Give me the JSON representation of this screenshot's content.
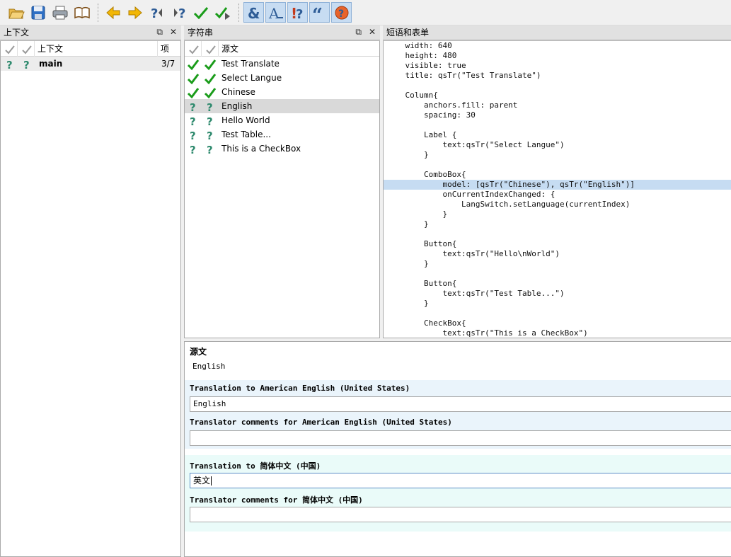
{
  "toolbar": {
    "icons": [
      "open-folder-icon",
      "save-icon",
      "print-icon",
      "phrasebook-icon",
      "arrow-left-icon",
      "arrow-right-icon",
      "prev-unfinished-icon",
      "next-unfinished-icon",
      "done-icon",
      "done-and-next-icon",
      "accelerator-validation-icon",
      "punctuation-validation-icon",
      "phrase-validation-icon",
      "quote-validation-icon",
      "placeholder-validation-icon"
    ]
  },
  "context_panel": {
    "title": "上下文",
    "col_name": "上下文",
    "col_items": "项",
    "rows": [
      {
        "name": "main",
        "items": "3/7"
      }
    ]
  },
  "strings_panel": {
    "title": "字符串",
    "col_source": "源文",
    "rows": [
      {
        "text": "Test Translate",
        "status": "done"
      },
      {
        "text": "Select Langue",
        "status": "done"
      },
      {
        "text": "Chinese",
        "status": "done"
      },
      {
        "text": "English",
        "status": "unfinished",
        "selected": true
      },
      {
        "text": "Hello World",
        "status": "unfinished"
      },
      {
        "text": "Test Table...",
        "status": "unfinished"
      },
      {
        "text": "This is a CheckBox",
        "status": "unfinished"
      }
    ]
  },
  "phrases_panel": {
    "title": "短语和表单",
    "code_lines": [
      "    width: 640",
      "    height: 480",
      "    visible: true",
      "    title: qsTr(\"Test Translate\")",
      "",
      "    Column{",
      "        anchors.fill: parent",
      "        spacing: 30",
      "",
      "        Label {",
      "            text:qsTr(\"Select Langue\")",
      "        }",
      "",
      "        ComboBox{",
      "            model: [qsTr(\"Chinese\"), qsTr(\"English\")]",
      "            onCurrentIndexChanged: {",
      "                LangSwitch.setLanguage(currentIndex)",
      "            }",
      "        }",
      "",
      "        Button{",
      "            text:qsTr(\"Hello\\nWorld\")",
      "        }",
      "",
      "        Button{",
      "            text:qsTr(\"Test Table...\")",
      "        }",
      "",
      "        CheckBox{",
      "            text:qsTr(\"This is a CheckBox\")"
    ],
    "highlight_line": 14
  },
  "editor": {
    "source_label": "源文",
    "source_text": "English",
    "translation_en_label": "Translation to American English (United States)",
    "translation_en_value": "English",
    "comments_en_label": "Translator comments for American English (United States)",
    "comments_en_value": "",
    "translation_zh_label": "Translation to 简体中文 (中国)",
    "translation_zh_value": "英文",
    "comments_zh_label": "Translator comments for 简体中文 (中国)",
    "comments_zh_value": ""
  },
  "colors": {
    "done": "#1a9c1a",
    "unfinished": "#2f8a6e",
    "band_en": "#eaf4fb",
    "band_zh": "#eafbf9",
    "highlight": "#c6dcf2"
  }
}
